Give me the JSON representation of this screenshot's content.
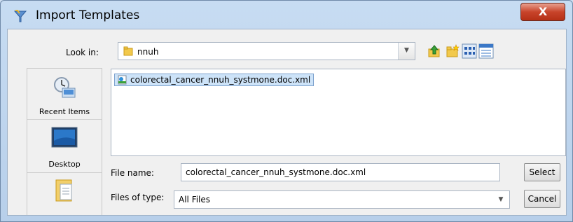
{
  "window": {
    "title": "Import Templates",
    "close_glyph": "X"
  },
  "lookin": {
    "label": "Look in:",
    "value": "nnuh"
  },
  "places": [
    {
      "label": "Recent Items",
      "icon": "recent-items-icon"
    },
    {
      "label": "Desktop",
      "icon": "desktop-icon"
    },
    {
      "label": "",
      "icon": "documents-icon"
    }
  ],
  "files": [
    {
      "name": "colorectal_cancer_nnuh_systmone.doc.xml",
      "selected": true
    }
  ],
  "filename": {
    "label": "File name:",
    "value": "colorectal_cancer_nnuh_systmone.doc.xml"
  },
  "filetype": {
    "label": "Files of type:",
    "value": "All Files"
  },
  "buttons": {
    "select": "Select",
    "cancel": "Cancel"
  }
}
